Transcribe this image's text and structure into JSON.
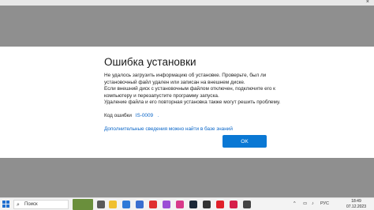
{
  "window": {
    "close_glyph": "×"
  },
  "dialog": {
    "title": "Ошибка установки",
    "message_lines": [
      "Не удалось загрузить информацию об установке. Проверьте, был ли",
      "установочный файл удален или записан на внешнем диске.",
      "Если внешний диск с установочным файлом отключен, подключите его к",
      "компьютеру и перезапустите программу запуска.",
      "Удаление файла и его повторная установка также могут решить проблему."
    ],
    "error_code_label": "Код ошибки",
    "error_code_value": "IS-0009",
    "error_code_dot": ".",
    "more_info_link": "Дополнительные сведения можно найти в базе знаний",
    "ok_label": "OK"
  },
  "taskbar": {
    "search_placeholder": "Поиск",
    "apps": [
      {
        "name": "minecraft-thumbnail",
        "color": "#6a8f3c"
      },
      {
        "name": "task-view-icon",
        "color": "#5a5a5a"
      },
      {
        "name": "file-explorer-icon",
        "color": "#f0c030"
      },
      {
        "name": "mail-icon",
        "color": "#2f7bd8"
      },
      {
        "name": "store-icon",
        "color": "#3a6fd0"
      },
      {
        "name": "yandex-icon",
        "color": "#e03030"
      },
      {
        "name": "podcast-icon",
        "color": "#9b4fd6"
      },
      {
        "name": "photos-icon",
        "color": "#d83a8a"
      },
      {
        "name": "steam-icon",
        "color": "#1b2838"
      },
      {
        "name": "epic-icon",
        "color": "#333333"
      },
      {
        "name": "opera-icon",
        "color": "#e0202a"
      },
      {
        "name": "opera-gx-icon",
        "color": "#d61f4a"
      },
      {
        "name": "app-icon",
        "color": "#444444"
      }
    ],
    "tray": {
      "chevron": "^",
      "lang": "РУС",
      "time": "18:49",
      "date": "07.12.2023"
    }
  }
}
